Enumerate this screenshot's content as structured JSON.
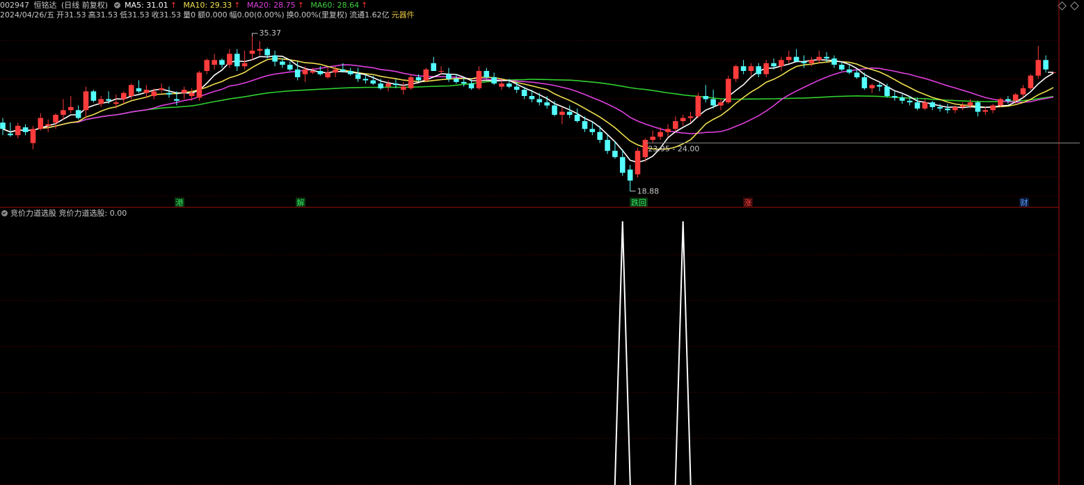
{
  "header": {
    "code": "002947",
    "name": "恒铭达",
    "period": "(日线 前复权)",
    "ma": [
      {
        "label": "MA5: 31.01",
        "arrow": "↑",
        "color": "#ffffff"
      },
      {
        "label": "MA10: 29.33",
        "arrow": "↑",
        "color": "#f0e050"
      },
      {
        "label": "MA20: 28.75",
        "arrow": "↑",
        "color": "#e040e0"
      },
      {
        "label": "MA60: 28.64",
        "arrow": "↑",
        "color": "#40d040"
      }
    ],
    "date": "2024/04/26/五",
    "open": "开31.53",
    "high": "高31.53",
    "low": "低31.53",
    "close": "收31.53",
    "vol": "量0",
    "amount": "额0.000",
    "change": "幅0.00(0.00%)",
    "turnover": "换0.00%(里复权)",
    "float": "流通1.62亿",
    "sector": "元器件"
  },
  "annotations": {
    "peak_label": "35.37",
    "range_label": "23.95 - 24.00",
    "low_label": "18.88"
  },
  "event_markers": [
    {
      "text": "港",
      "bg": "#0a3a12",
      "fg": "#30e060"
    },
    {
      "text": "解",
      "bg": "#0a3a12",
      "fg": "#30e060"
    },
    {
      "text": "跌回",
      "bg": "#0a3a12",
      "fg": "#30e060"
    },
    {
      "text": "涨",
      "bg": "#3a0a0a",
      "fg": "#ff4040"
    },
    {
      "text": "财",
      "bg": "#0a1a3a",
      "fg": "#60a0ff"
    }
  ],
  "indicator": {
    "name": "竞价力道选股",
    "value_label": "竞价力道选股: 0.00"
  },
  "colors": {
    "up": "#ff3c3c",
    "down": "#54ffff",
    "grid": "#5a0000",
    "axis": "#a01010"
  },
  "chart_data": {
    "type": "candlestick",
    "ylim": [
      17.3,
      37.0
    ],
    "indicator_ylim": [
      0,
      1
    ],
    "ohlc": [
      [
        26.17,
        26.67,
        24.83,
        25.5
      ],
      [
        25.0,
        26.17,
        24.67,
        24.83
      ],
      [
        24.83,
        26.17,
        24.5,
        25.83
      ],
      [
        25.67,
        26.0,
        24.83,
        25.17
      ],
      [
        24.0,
        25.83,
        23.33,
        25.5
      ],
      [
        25.5,
        27.17,
        25.33,
        26.67
      ],
      [
        25.83,
        26.5,
        25.17,
        26.0
      ],
      [
        26.17,
        27.17,
        25.5,
        27.0
      ],
      [
        27.0,
        28.67,
        26.5,
        27.5
      ],
      [
        27.5,
        29.0,
        27.17,
        27.83
      ],
      [
        27.5,
        28.0,
        26.5,
        26.67
      ],
      [
        27.5,
        30.0,
        26.67,
        29.5
      ],
      [
        29.5,
        29.67,
        28.33,
        28.5
      ],
      [
        28.17,
        29.0,
        27.83,
        28.67
      ],
      [
        28.67,
        29.5,
        28.17,
        28.5
      ],
      [
        28.17,
        29.17,
        27.67,
        28.33
      ],
      [
        28.67,
        29.5,
        28.17,
        29.33
      ],
      [
        29.0,
        30.33,
        28.67,
        30.17
      ],
      [
        29.83,
        30.67,
        29.33,
        29.5
      ],
      [
        29.33,
        30.17,
        28.83,
        29.67
      ],
      [
        29.0,
        29.83,
        28.67,
        29.5
      ],
      [
        29.67,
        30.33,
        29.33,
        29.83
      ],
      [
        29.33,
        30.0,
        28.83,
        29.17
      ],
      [
        28.67,
        29.5,
        28.0,
        28.5
      ],
      [
        29.33,
        30.0,
        28.67,
        29.67
      ],
      [
        29.0,
        29.83,
        28.5,
        29.33
      ],
      [
        28.83,
        31.67,
        28.5,
        31.5
      ],
      [
        31.67,
        33.0,
        31.33,
        32.83
      ],
      [
        32.33,
        33.5,
        31.83,
        32.83
      ],
      [
        32.83,
        33.0,
        32.0,
        32.33
      ],
      [
        32.33,
        34.0,
        32.0,
        33.5
      ],
      [
        33.5,
        34.0,
        31.67,
        32.17
      ],
      [
        32.17,
        33.83,
        31.83,
        32.5
      ],
      [
        33.5,
        35.37,
        32.83,
        33.83
      ],
      [
        33.83,
        34.83,
        33.33,
        34.0
      ],
      [
        34.0,
        34.17,
        33.0,
        33.33
      ],
      [
        33.33,
        33.83,
        32.17,
        32.67
      ],
      [
        32.67,
        33.0,
        32.0,
        32.33
      ],
      [
        32.33,
        32.67,
        31.67,
        31.83
      ],
      [
        31.83,
        32.67,
        30.67,
        31.0
      ],
      [
        31.33,
        32.17,
        30.5,
        31.83
      ],
      [
        31.5,
        32.0,
        31.33,
        31.67
      ],
      [
        31.67,
        32.17,
        31.17,
        31.33
      ],
      [
        31.0,
        32.0,
        30.83,
        31.5
      ],
      [
        31.5,
        32.17,
        31.0,
        31.83
      ],
      [
        31.83,
        32.5,
        31.5,
        31.67
      ],
      [
        31.67,
        32.0,
        31.17,
        31.33
      ],
      [
        31.33,
        32.0,
        30.5,
        30.83
      ],
      [
        30.83,
        31.33,
        30.33,
        30.67
      ],
      [
        30.67,
        31.17,
        30.17,
        30.33
      ],
      [
        30.33,
        30.83,
        29.67,
        29.83
      ],
      [
        30.0,
        30.67,
        29.5,
        30.33
      ],
      [
        30.33,
        30.83,
        29.83,
        30.17
      ],
      [
        29.67,
        30.5,
        29.17,
        30.0
      ],
      [
        29.83,
        31.33,
        29.67,
        31.0
      ],
      [
        31.0,
        31.33,
        30.5,
        30.67
      ],
      [
        30.67,
        32.0,
        30.5,
        31.83
      ],
      [
        32.5,
        33.17,
        31.67,
        31.67
      ],
      [
        31.67,
        32.17,
        31.33,
        31.67
      ],
      [
        31.33,
        32.0,
        30.5,
        30.83
      ],
      [
        30.83,
        31.33,
        30.33,
        30.5
      ],
      [
        30.5,
        31.0,
        30.0,
        30.33
      ],
      [
        30.33,
        30.83,
        29.67,
        29.83
      ],
      [
        29.83,
        32.17,
        29.67,
        31.67
      ],
      [
        31.67,
        32.0,
        30.83,
        31.0
      ],
      [
        31.0,
        31.5,
        30.17,
        30.33
      ],
      [
        30.0,
        30.67,
        29.67,
        30.33
      ],
      [
        30.33,
        30.83,
        29.83,
        30.0
      ],
      [
        30.0,
        30.5,
        29.33,
        29.67
      ],
      [
        29.67,
        30.0,
        28.67,
        29.0
      ],
      [
        29.0,
        29.67,
        28.33,
        28.67
      ],
      [
        28.67,
        29.33,
        28.0,
        28.33
      ],
      [
        28.33,
        29.0,
        27.67,
        28.0
      ],
      [
        28.0,
        28.5,
        26.83,
        27.0
      ],
      [
        27.0,
        27.83,
        26.0,
        27.33
      ],
      [
        27.33,
        28.0,
        26.67,
        27.0
      ],
      [
        27.0,
        27.67,
        26.17,
        26.33
      ],
      [
        26.33,
        26.83,
        25.17,
        25.5
      ],
      [
        25.5,
        26.33,
        24.83,
        25.17
      ],
      [
        25.17,
        25.83,
        24.0,
        24.33
      ],
      [
        24.33,
        24.83,
        22.83,
        23.17
      ],
      [
        23.17,
        24.17,
        22.33,
        22.5
      ],
      [
        22.5,
        23.33,
        20.5,
        20.83
      ],
      [
        21.17,
        21.67,
        18.88,
        20.0
      ],
      [
        20.67,
        23.5,
        20.33,
        23.17
      ],
      [
        22.5,
        24.5,
        22.0,
        24.33
      ],
      [
        24.33,
        25.33,
        24.0,
        24.67
      ],
      [
        24.67,
        25.67,
        24.33,
        25.17
      ],
      [
        25.17,
        26.0,
        24.67,
        25.5
      ],
      [
        25.5,
        26.83,
        25.17,
        26.33
      ],
      [
        26.33,
        27.0,
        25.83,
        26.67
      ],
      [
        26.67,
        27.33,
        26.17,
        26.83
      ],
      [
        26.83,
        29.33,
        26.67,
        29.0
      ],
      [
        29.0,
        30.17,
        28.33,
        28.67
      ],
      [
        28.67,
        29.67,
        27.67,
        28.0
      ],
      [
        28.0,
        28.67,
        27.5,
        28.33
      ],
      [
        28.33,
        31.17,
        28.17,
        30.83
      ],
      [
        30.83,
        32.33,
        30.5,
        32.17
      ],
      [
        32.17,
        32.83,
        31.33,
        31.67
      ],
      [
        31.67,
        32.5,
        31.17,
        32.17
      ],
      [
        32.17,
        32.5,
        31.0,
        31.33
      ],
      [
        31.33,
        32.83,
        31.0,
        32.5
      ],
      [
        32.5,
        33.0,
        31.83,
        32.17
      ],
      [
        32.17,
        33.17,
        31.67,
        32.83
      ],
      [
        32.83,
        33.83,
        32.5,
        33.17
      ],
      [
        33.17,
        34.0,
        32.67,
        32.67
      ],
      [
        32.67,
        33.33,
        32.0,
        32.5
      ],
      [
        32.5,
        33.17,
        32.17,
        32.83
      ],
      [
        32.83,
        33.83,
        32.5,
        33.17
      ],
      [
        33.17,
        33.67,
        32.67,
        33.0
      ],
      [
        33.0,
        33.33,
        32.0,
        32.33
      ],
      [
        32.33,
        32.67,
        31.67,
        31.83
      ],
      [
        31.83,
        32.33,
        31.33,
        31.5
      ],
      [
        31.5,
        31.83,
        30.83,
        31.0
      ],
      [
        31.0,
        31.5,
        29.67,
        29.83
      ],
      [
        29.83,
        30.33,
        29.33,
        30.17
      ],
      [
        30.17,
        30.5,
        29.5,
        30.0
      ],
      [
        30.0,
        30.33,
        28.83,
        29.0
      ],
      [
        29.0,
        29.5,
        28.5,
        28.83
      ],
      [
        28.83,
        29.17,
        28.17,
        28.5
      ],
      [
        28.5,
        29.0,
        28.0,
        28.33
      ],
      [
        28.33,
        28.83,
        27.5,
        27.67
      ],
      [
        27.67,
        28.67,
        27.5,
        28.33
      ],
      [
        28.33,
        28.5,
        27.5,
        27.83
      ],
      [
        27.83,
        28.17,
        27.33,
        27.67
      ],
      [
        27.67,
        28.17,
        27.17,
        27.5
      ],
      [
        27.5,
        28.0,
        27.17,
        27.83
      ],
      [
        27.83,
        28.33,
        27.5,
        28.0
      ],
      [
        28.0,
        28.67,
        27.67,
        28.33
      ],
      [
        28.33,
        28.5,
        26.83,
        27.33
      ],
      [
        27.33,
        27.83,
        27.0,
        27.5
      ],
      [
        27.5,
        28.17,
        27.17,
        28.0
      ],
      [
        28.0,
        28.83,
        27.83,
        28.67
      ],
      [
        28.67,
        29.0,
        28.17,
        28.5
      ],
      [
        28.5,
        29.33,
        28.17,
        29.17
      ],
      [
        29.17,
        30.17,
        28.83,
        29.83
      ],
      [
        29.83,
        31.33,
        29.67,
        31.17
      ],
      [
        31.17,
        34.33,
        30.83,
        32.83
      ],
      [
        32.83,
        33.33,
        31.5,
        31.83
      ],
      [
        31.53,
        31.53,
        31.53,
        31.53
      ]
    ],
    "ma_values": {
      "MA5": 31.01,
      "MA10": 29.33,
      "MA20": 28.75,
      "MA60": 28.64
    },
    "indicator_spikes": [
      {
        "bar": 82,
        "value": 1.0
      },
      {
        "bar": 90,
        "value": 1.0
      }
    ]
  }
}
